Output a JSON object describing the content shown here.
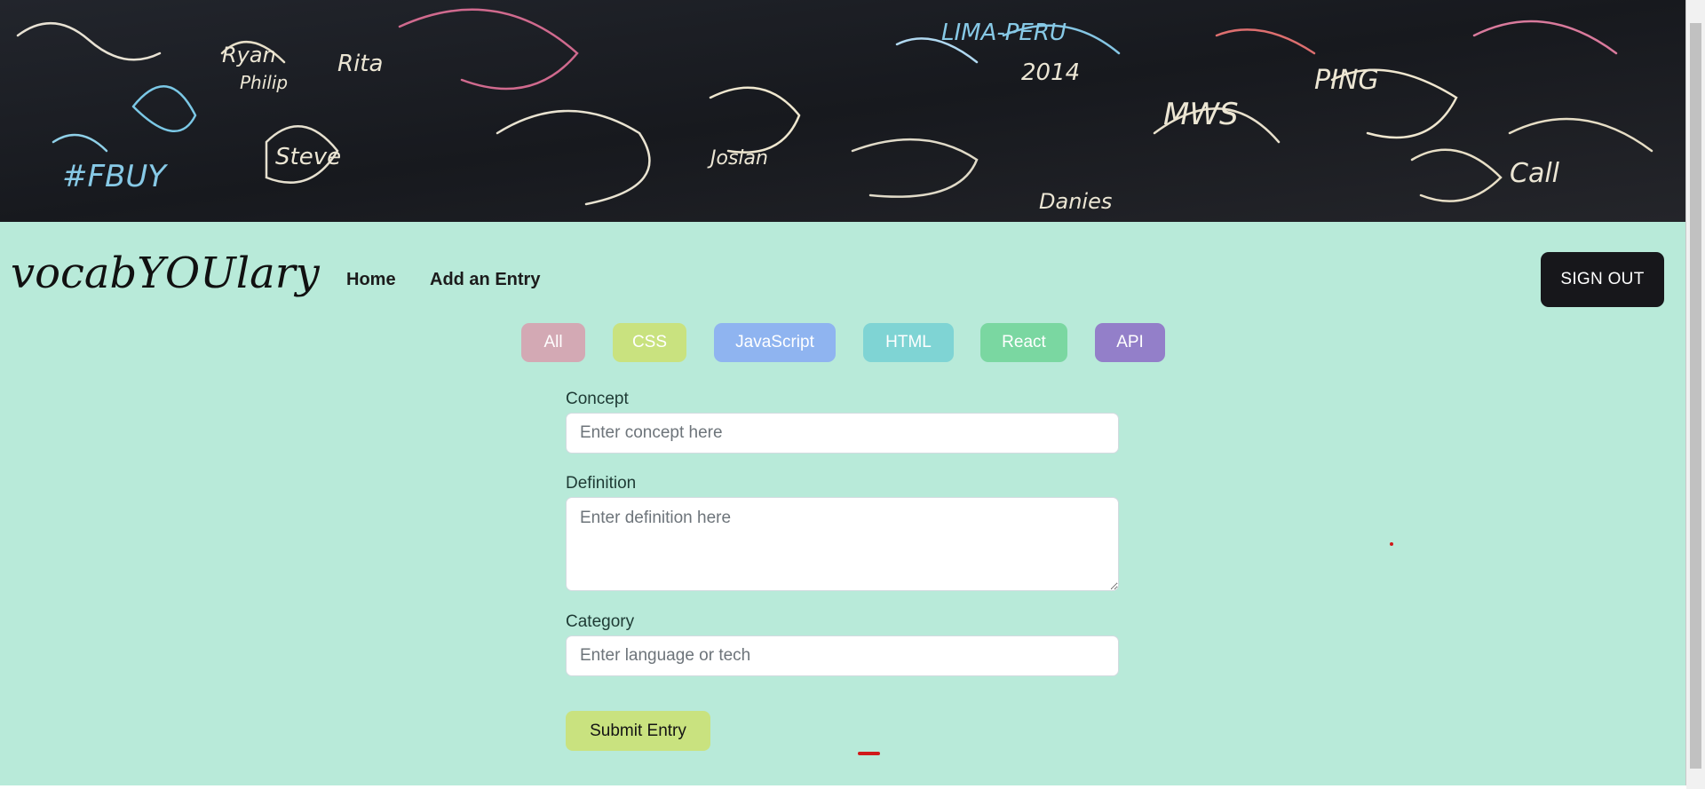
{
  "app": {
    "brand": "vocabYOUlary"
  },
  "nav": {
    "links": [
      {
        "label": "Home"
      },
      {
        "label": "Add an Entry"
      }
    ],
    "sign_out_label": "SIGN OUT"
  },
  "categories": [
    {
      "label": "All",
      "color": "#d3a9b4"
    },
    {
      "label": "CSS",
      "color": "#c9e27f"
    },
    {
      "label": "JavaScript",
      "color": "#8fb4f0"
    },
    {
      "label": "HTML",
      "color": "#7fd4d4"
    },
    {
      "label": "React",
      "color": "#7ad7a1"
    },
    {
      "label": "API",
      "color": "#937fc9"
    }
  ],
  "form": {
    "concept_label": "Concept",
    "concept_placeholder": "Enter concept here",
    "definition_label": "Definition",
    "definition_placeholder": "Enter definition here",
    "category_label": "Category",
    "category_placeholder": "Enter language or tech",
    "submit_label": "Submit Entry"
  },
  "colors": {
    "page_background": "#b8ead9",
    "sign_out_background": "#17171b"
  },
  "banner": {
    "scribbles": [
      "Ryan",
      "Philip",
      "Rita",
      "Steve",
      "PING",
      "#FBUY",
      "LIMA-PERU",
      "2014",
      "MWS",
      "Call",
      "Josian",
      "Danies"
    ]
  }
}
